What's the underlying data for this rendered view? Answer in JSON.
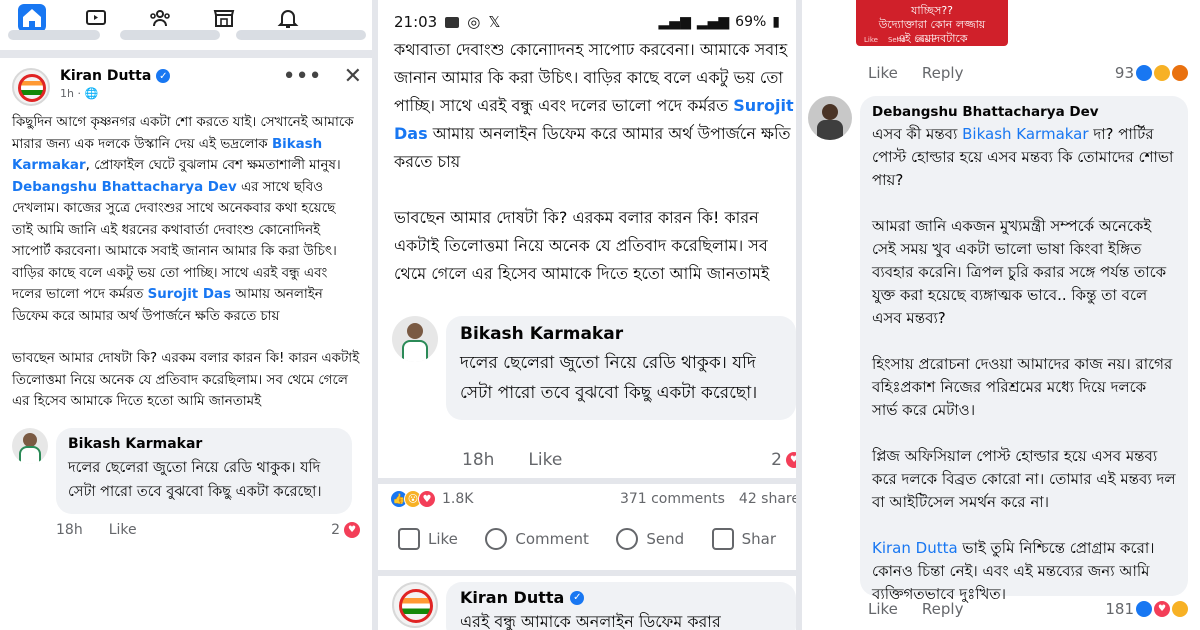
{
  "panel1": {
    "post_author": "Kiran Dutta",
    "post_time": "1h ·",
    "post_paragraph1_pre": "কিছুদিন আগে কৃষ্ণনগর একটা শো করতে যাই। সেখানেই আমাকে মারার জন্য এক দলকে উস্কানি দেয় এই ভদ্রলোক ",
    "post_link1": "Bikash Karmakar",
    "post_paragraph1_mid1": ", প্রোফাইল ঘেটে বুঝলাম বেশ ক্ষমতাশালী মানুষ। ",
    "post_link2": "Debangshu Bhattacharya Dev",
    "post_paragraph1_mid2": " এর সাথে ছবিও দেখলাম। কাজের সুত্রে দেবাংশুর সাথে অনেকবার কথা হয়েছে তাই আমি জানি এই ধরনের কথাবার্তা দেবাংশু কোনোদিনই সাপোর্ট করবেনা। আমাকে সবাই জানান আমার কি করা উচিৎ।  বাড়ির কাছে বলে একটু ভয় তো পাচ্ছি। সাথে এরই বন্ধু এবং দলের ভালো পদে কর্মরত ",
    "post_link3": "Surojit Das",
    "post_paragraph1_end": " আমায় অনলাইন ডিফেম করে আমার অর্থ উপার্জনে ক্ষতি করতে চায়",
    "post_paragraph2": "ভাবছেন আমার দোষটা কি? এরকম বলার কারন কি! কারন একটাই তিলোত্তমা নিয়ে অনেক যে প্রতিবাদ করেছিলাম। সব থেমে গেলে এর হিসেব আমাকে দিতে হতো আমি জানতামই",
    "comment_author": "Bikash Karmakar",
    "comment_text": "দলের ছেলেরা জুতো নিয়ে রেডি থাকুক। যদি সেটা পারো তবে বুঝবো কিছু একটা করেছো।",
    "comment_time": "18h",
    "comment_like": "Like",
    "comment_count": "2"
  },
  "panel2": {
    "status_time": "21:03",
    "status_battery": "69%",
    "text_line_top": "কথাবার্তা দেবাংশু কোনোদিনই সাপোর্ট করবেনা। আমাকে সবাই জানান আমার কি করা উচিৎ।  বাড়ির কাছে বলে একটু ভয় তো পাচ্ছি। সাথে এরই বন্ধু এবং দলের ভালো পদে কর্মরত ",
    "text_link": "Surojit Das",
    "text_line_end": " আমায় অনলাইন ডিফেম করে আমার অর্থ উপার্জনে ক্ষতি করতে চায়",
    "text_paragraph2": "ভাবছেন আমার দোষটা কি? এরকম বলার কারন কি! কারন একটাই তিলোত্তমা নিয়ে অনেক যে প্রতিবাদ করেছিলাম। সব থেমে গেলে এর হিসেব আমাকে দিতে হতো আমি জানতামই",
    "comment_author": "Bikash Karmakar",
    "comment_text": "দলের ছেলেরা জুতো নিয়ে রেডি থাকুক। যদি সেটা পারো তবে বুঝবো কিছু একটা করেছো।",
    "comment_time": "18h",
    "comment_like": "Like",
    "comment_count": "2",
    "reactions_count": "1.8K",
    "comments_count": "371 comments",
    "shares_count": "42 share",
    "action_like": "Like",
    "action_comment": "Comment",
    "action_send": "Send",
    "action_share": "Shar",
    "bottom_author": "Kiran Dutta",
    "bottom_text": "এরই বন্ধু আমাকে অনলাইন ডিফেম করার"
  },
  "panel3": {
    "image_text_line1": "যাচ্ছিস??",
    "image_text_line2": "উদ্যোক্তারা কোন লজ্জায়",
    "image_text_line3": "এই বেয়াদবটাকে",
    "image_mini_like": "Like",
    "image_mini_send": "Send",
    "image_mini_share": "Share",
    "top_like": "Like",
    "top_reply": "Reply",
    "top_count": "93",
    "comment_author": "Debangshu Bhattacharya Dev",
    "para1_pre": "এসব কী মন্তব্য ",
    "para1_link": "Bikash Karmakar",
    "para1_post": " দা? পার্টির পোস্ট হোল্ডার হয়ে এসব মন্তব্য কি তোমাদের শোভা পায়?",
    "para2": "আমরা জানি একজন মুখ্যমন্ত্রী সম্পর্কে অনেকেই সেই সময় খুব একটা ভালো ভাষা কিংবা ইঙ্গিত ব্যবহার করেনি। ত্রিপল চুরি করার সঙ্গে পর্যন্ত তাকে যুক্ত করা হয়েছে ব্যঙ্গাত্মক ভাবে.. কিন্তু তা বলে এসব মন্তব্য?",
    "para3": "হিংসায় প্ররোচনা দেওয়া আমাদের কাজ নয়। রাগের বহিঃপ্রকাশ নিজের পরিশ্রমের মধ্যে দিয়ে দলকে সার্ভ করে মেটাও।",
    "para4": "প্লিজ অফিসিয়াল পোস্ট হোল্ডার হয়ে এসব মন্তব্য করে দলকে বিব্রত কোরো না। তোমার এই মন্তব্য দল বা আইটিসেল সমর্থন করে না।",
    "para5_link": "Kiran Dutta",
    "para5_post": " ভাই তুমি নিশ্চিন্তে প্রোগ্রাম করো। কোনও চিন্তা নেই। এবং এই মন্তব্যের জন্য আমি ব্যক্তিগতভাবে দুঃখিত।",
    "foot_like": "Like",
    "foot_reply": "Reply",
    "foot_count": "181"
  },
  "colors": {
    "accent": "#1877f2",
    "bubble": "#f0f2f5",
    "meta": "#65676b",
    "banner": "#d0202a"
  }
}
